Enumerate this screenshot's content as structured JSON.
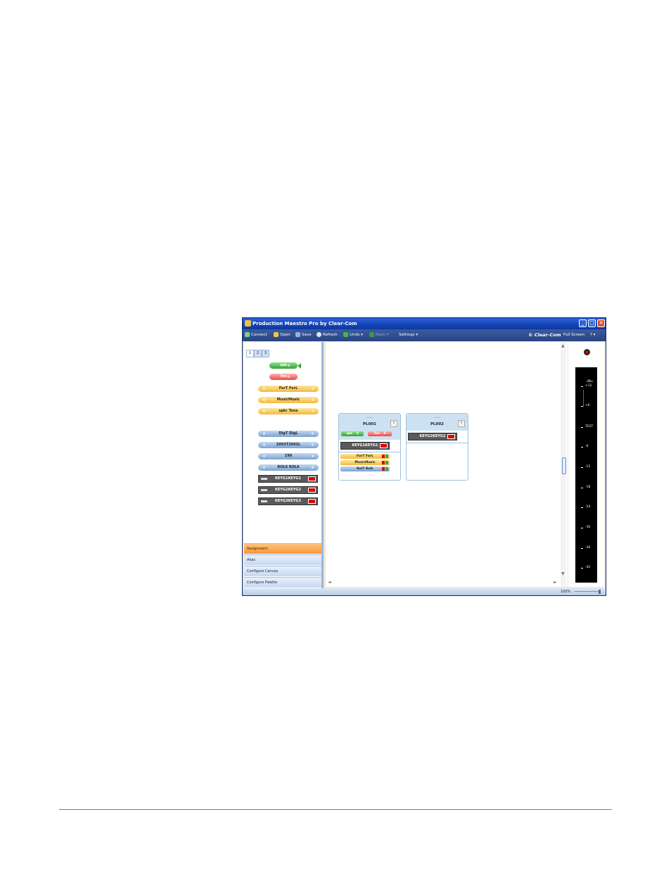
{
  "window": {
    "title": "Production Maestro Pro by Clear-Com",
    "min": "_",
    "max": "□",
    "close": "✕"
  },
  "toolbar": {
    "connect": "Connect",
    "open": "Open",
    "save": "Save",
    "refresh": "Refresh",
    "undo": "Undo",
    "redo": "Redo",
    "settings": "Settings",
    "brand": "Clear-Com",
    "fullscreen": "Full Screen",
    "help": "?",
    "undo_arrow": "▾",
    "redo_arrow": "▾",
    "settings_arrow": "▾",
    "help_arrow": "▾",
    "accent": "#2a4482"
  },
  "palette": {
    "tabs": [
      "1",
      "2",
      "3"
    ],
    "green_pill": {
      "label": "spk",
      "level": "0"
    },
    "red_pill": {
      "label": "Ton",
      "level": "0"
    },
    "yellow_pills": [
      {
        "label": "ForT ForL",
        "l": "0",
        "r": "0"
      },
      {
        "label": "MusicMusic",
        "l": "0",
        "r": "0"
      },
      {
        "label": "spkr Tone",
        "l": "0",
        "r": "0"
      }
    ],
    "blue_pills": [
      {
        "label": "DigT DigL",
        "l": "0",
        "r": "0"
      },
      {
        "label": "2003T2003L",
        "l": "0",
        "r": "0"
      },
      {
        "label": "190",
        "l": "0",
        "r": "0"
      },
      {
        "label": "ROL6 ROL6",
        "l": "0",
        "r": "0"
      }
    ],
    "keys": [
      "KEYG1KEYG1",
      "KEYG2KEYG2",
      "KEYG3KEYG3"
    ]
  },
  "nav": [
    "Assignment",
    "Alias",
    "Configure Canvas",
    "Configure Palette"
  ],
  "canvas": {
    "cards": [
      {
        "dots": "......",
        "name": "PL001",
        "t": "T",
        "spk": "spk",
        "spk_level": "0",
        "ton": "Ton",
        "ton_level": "0",
        "key": "KEYG1KEYG1",
        "rows": [
          "ForT ForL",
          "MusicMusic",
          "RolT RolL"
        ]
      },
      {
        "dots": "......",
        "name": "PL002",
        "t": "T",
        "key": "KEYG2KEYG2"
      }
    ],
    "up_arrow": "▲",
    "down_arrow": "▼",
    "left_arrow": "◄",
    "right_arrow": "►"
  },
  "meter": {
    "unit": "dBu",
    "ticks": [
      "+12",
      "+6",
      "TEST",
      "-6",
      "-12",
      "-18",
      "-24",
      "-30",
      "-36",
      "-42"
    ]
  },
  "status": {
    "zoom": "100%"
  }
}
